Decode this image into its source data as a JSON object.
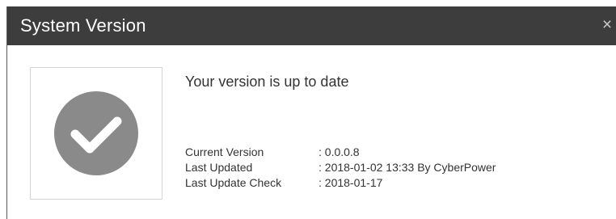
{
  "dialog": {
    "title": "System Version",
    "close_glyph": "×",
    "close_icon": "close-icon"
  },
  "status": {
    "icon": "checkmark-circle-icon",
    "icon_color": "#8a8a8a",
    "message": "Your version is up to date"
  },
  "info": {
    "rows": [
      {
        "label": "Current Version",
        "value": ": 0.0.0.8"
      },
      {
        "label": "Last Updated",
        "value": ": 2018-01-02 13:33 By CyberPower"
      },
      {
        "label": "Last Update Check",
        "value": ": 2018-01-17"
      }
    ]
  },
  "colors": {
    "titlebar_bg": "#3d3d3d",
    "title_text": "#ffffff",
    "body_text": "#333333"
  }
}
